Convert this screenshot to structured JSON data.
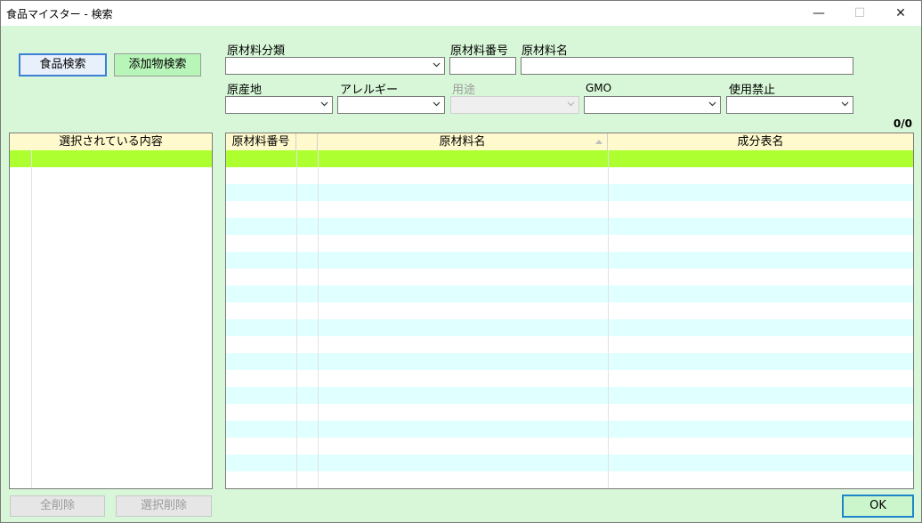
{
  "window": {
    "title": "食品マイスター - 検索",
    "minimize_glyph": "—",
    "maximize_glyph": "☐",
    "close_glyph": "✕"
  },
  "buttons": {
    "food_search": "食品検索",
    "additive_search": "添加物検索",
    "clear_all": "全削除",
    "clear_selected": "選択削除",
    "ok": "OK"
  },
  "filters": {
    "category_label": "原材料分類",
    "material_number_label": "原材料番号",
    "material_name_label": "原材料名",
    "origin_label": "原産地",
    "allergy_label": "アレルギー",
    "usage_label": "用途",
    "gmo_label": "GMO",
    "prohibited_label": "使用禁止"
  },
  "count": "0/0",
  "selected_panel": {
    "header": "選択されている内容"
  },
  "results_table": {
    "columns": [
      "原材料番号",
      "原材料名",
      "成分表名"
    ]
  },
  "colors": {
    "client_bg": "#d8f7d8",
    "header_bg": "#fffacd",
    "selected_row": "#adff2f",
    "alt_row": "#e0ffff"
  }
}
